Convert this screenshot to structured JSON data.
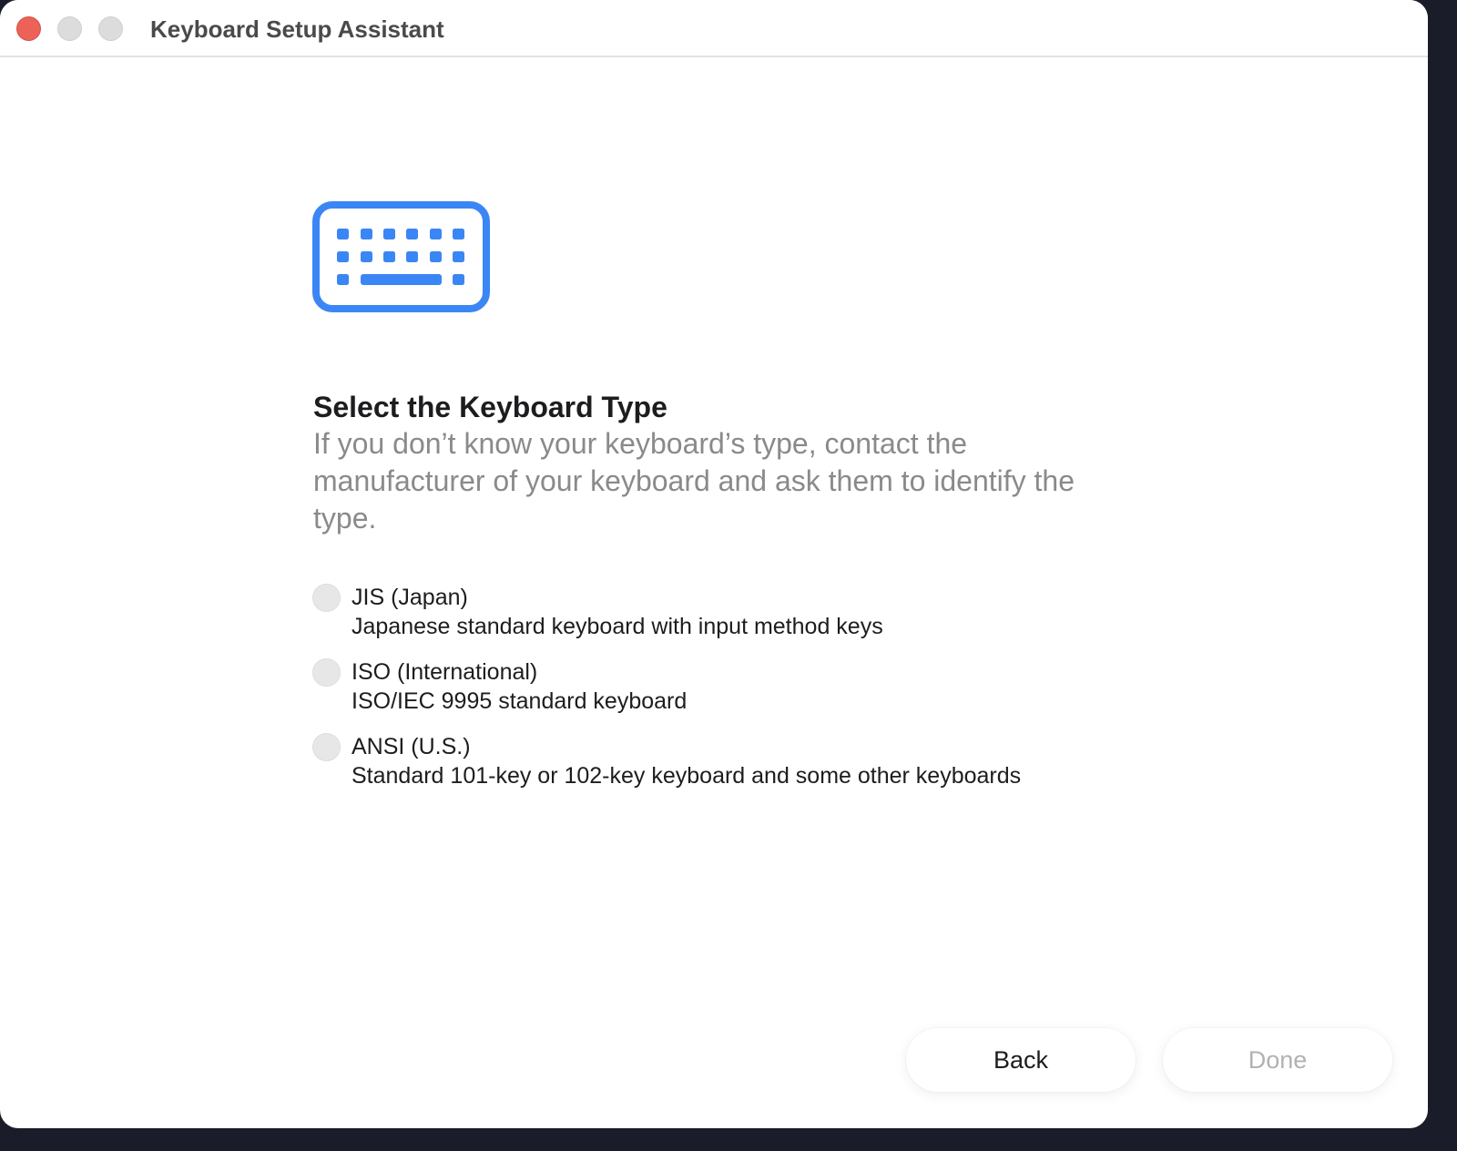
{
  "window": {
    "title": "Keyboard Setup Assistant"
  },
  "main": {
    "icon": "keyboard-icon",
    "accent_color": "#3b86f5",
    "heading": "Select the Keyboard Type",
    "description": "If you don’t know your keyboard’s type, contact the manufacturer of your keyboard and ask them to identify the type.",
    "options": [
      {
        "label": "JIS (Japan)",
        "description": "Japanese standard keyboard with input method keys",
        "selected": false
      },
      {
        "label": "ISO (International)",
        "description": "ISO/IEC 9995 standard keyboard",
        "selected": false
      },
      {
        "label": "ANSI (U.S.)",
        "description": "Standard 101-key or 102-key keyboard and some other keyboards",
        "selected": false
      }
    ]
  },
  "footer": {
    "back_label": "Back",
    "done_label": "Done",
    "done_enabled": false
  }
}
